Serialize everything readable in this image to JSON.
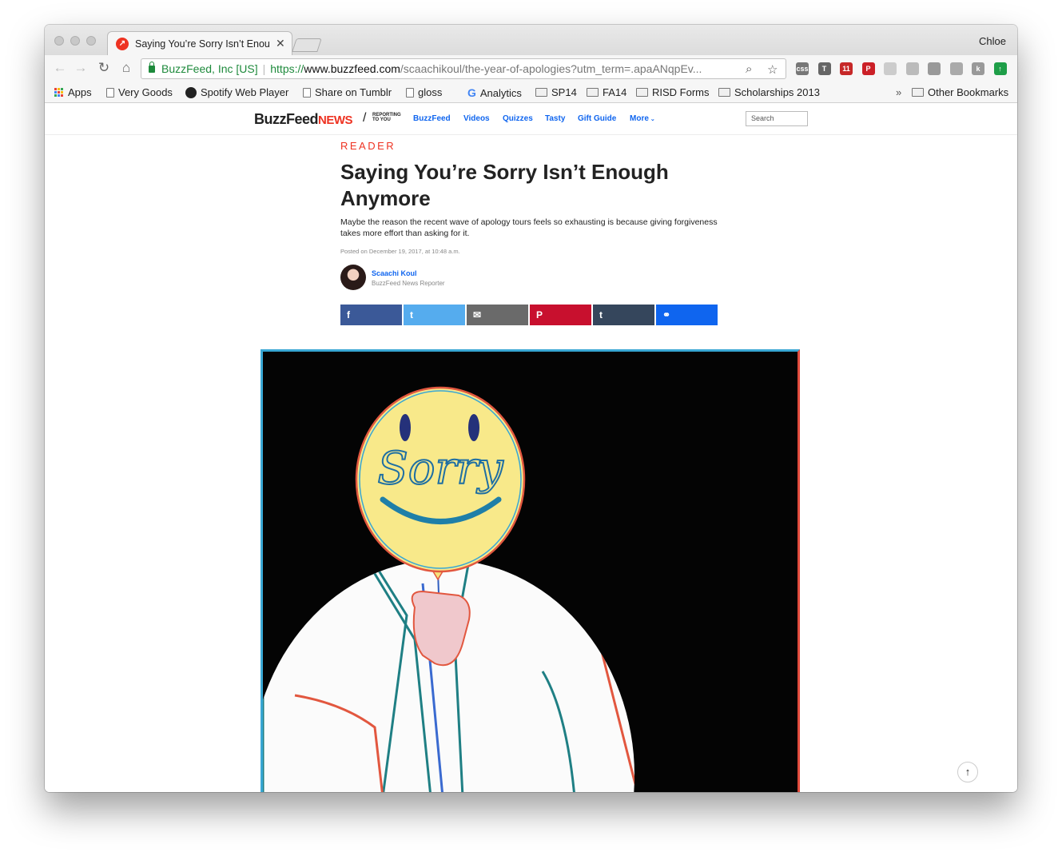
{
  "browser": {
    "tab_title": "Saying You’re Sorry Isn’t Enou",
    "profile_name": "Chloe",
    "address": {
      "org": "BuzzFeed, Inc [US]",
      "scheme": "https://",
      "host": "www.buzzfeed.com",
      "path": "/scaachikoul/the-year-of-apologies?utm_term=.apaANqpEv..."
    },
    "extensions": [
      {
        "icon": "css-icon",
        "label": "css",
        "color": "#777777"
      },
      {
        "icon": "text-icon",
        "label": "T",
        "color": "#666666"
      },
      {
        "icon": "calendar-icon",
        "label": "11",
        "color": "#c62828"
      },
      {
        "icon": "pinterest-icon",
        "label": "P",
        "color": "#cb2027"
      },
      {
        "icon": "extension-icon",
        "label": "",
        "color": "#cccccc"
      },
      {
        "icon": "extension-icon",
        "label": "",
        "color": "#bbbbbb"
      },
      {
        "icon": "dropbox-icon",
        "label": "",
        "color": "#999999"
      },
      {
        "icon": "drive-icon",
        "label": "",
        "color": "#aaaaaa"
      },
      {
        "icon": "k-icon",
        "label": "k",
        "color": "#999999"
      },
      {
        "icon": "upload-icon",
        "label": "↑",
        "color": "#1e9e48"
      }
    ],
    "bookmarks": [
      {
        "label": "Apps",
        "icon": "apps-icon"
      },
      {
        "label": "Very Goods",
        "icon": "page-icon"
      },
      {
        "label": "Spotify Web Player",
        "icon": "spotify-icon"
      },
      {
        "label": "Share on Tumblr",
        "icon": "page-icon"
      },
      {
        "label": "gloss",
        "icon": "page-icon"
      },
      {
        "label": "Analytics",
        "icon": "google-icon"
      },
      {
        "label": "SP14",
        "icon": "folder-icon"
      },
      {
        "label": "FA14",
        "icon": "folder-icon"
      },
      {
        "label": "RISD Forms",
        "icon": "folder-icon"
      },
      {
        "label": "Scholarships 2013",
        "icon": "folder-icon"
      }
    ],
    "overflow": "»",
    "other_bookmarks": "Other Bookmarks"
  },
  "site": {
    "logo_main": "BuzzFeed",
    "logo_news": "NEWS",
    "tagline_1": "REPORTING",
    "tagline_2": "TO YOU",
    "nav": [
      "BuzzFeed",
      "Videos",
      "Quizzes",
      "Tasty",
      "Gift Guide",
      "More"
    ],
    "search_placeholder": "Search"
  },
  "article": {
    "kicker": "READER",
    "headline": "Saying You’re Sorry Isn’t Enough Anymore",
    "dek": "Maybe the reason the recent wave of apology tours feels so exhausting is because giving forgiveness takes more effort than asking for it.",
    "posted": "Posted on December 19, 2017, at 10:48 a.m.",
    "author_name": "Scaachi Koul",
    "author_role": "BuzzFeed News Reporter",
    "share_buttons": [
      {
        "icon": "facebook-icon",
        "glyph": "f",
        "color": "#3b5998"
      },
      {
        "icon": "twitter-icon",
        "glyph": "t",
        "color": "#55acee"
      },
      {
        "icon": "email-icon",
        "glyph": "✉",
        "color": "#6a6a6a"
      },
      {
        "icon": "pinterest-icon",
        "glyph": "P",
        "color": "#c8102e"
      },
      {
        "icon": "tumblr-icon",
        "glyph": "t",
        "color": "#35465c"
      },
      {
        "icon": "link-icon",
        "glyph": "⚭",
        "color": "#0f65ef"
      }
    ],
    "balloon_text": "Sorry"
  },
  "back_to_top": "↑"
}
